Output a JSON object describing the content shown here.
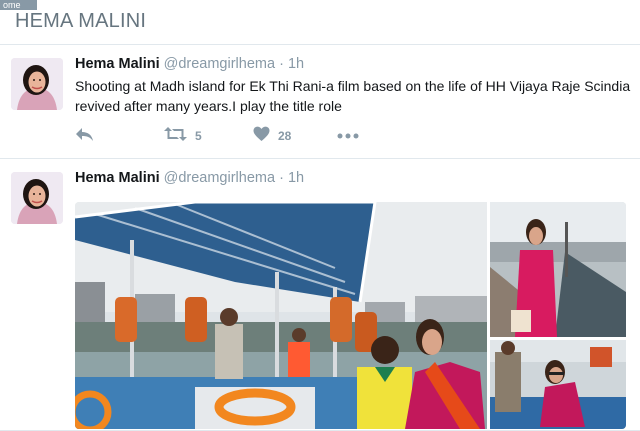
{
  "home_tag": "ome",
  "page": {
    "title": "HEMA MALINI"
  },
  "tweets": [
    {
      "name": "Hema Malini",
      "handle": "@dreamgirlhema",
      "dot": "·",
      "time": "1h",
      "text": "Shooting at Madh island for Ek Thi Rani-a film based on the life of HH Vijaya Raje Scindia revived after many years.I play the title role",
      "actions": {
        "retweets": "5",
        "likes": "28"
      }
    },
    {
      "name": "Hema Malini",
      "handle": "@dreamgirlhema",
      "dot": "·",
      "time": "1h"
    }
  ],
  "icons": [
    "reply-icon",
    "retweet-icon",
    "heart-icon",
    "more-icon"
  ],
  "colors": {
    "text_muted": "#8899a6",
    "border": "#e1e8ed",
    "title": "#66757f"
  }
}
